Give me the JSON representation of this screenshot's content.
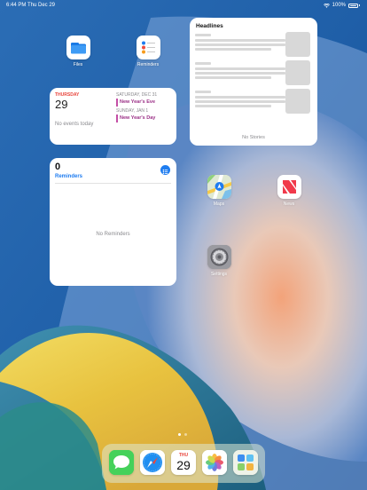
{
  "status_bar": {
    "time": "6:44 PM",
    "date": "Thu Dec 29",
    "battery": "100%"
  },
  "home": {
    "apps": [
      {
        "name": "files",
        "label": "Files",
        "icon": "folder-icon"
      },
      {
        "name": "reminders",
        "label": "Reminders",
        "icon": "reminders-list-icon"
      },
      {
        "name": "maps",
        "label": "Maps",
        "icon": "maps-icon"
      },
      {
        "name": "news",
        "label": "News",
        "icon": "news-icon"
      },
      {
        "name": "settings",
        "label": "Settings",
        "icon": "gear-icon"
      }
    ]
  },
  "calendar_widget": {
    "weekday": "THURSDAY",
    "day": "29",
    "empty_text": "No events today",
    "upcoming": [
      {
        "header": "SATURDAY, DEC 31",
        "event": "New Year's Eve"
      },
      {
        "header": "SUNDAY, JAN 1",
        "event": "New Year's Day"
      }
    ],
    "event_color": "#c44fa6"
  },
  "news_widget": {
    "title": "Headlines",
    "empty_text": "No Stories",
    "placeholder_rows": 3
  },
  "reminders_widget": {
    "count": "0",
    "list_name": "Reminders",
    "empty_text": "No Reminders",
    "accent": "#1e7cf0"
  },
  "page_indicator": {
    "pages": 2,
    "current": 1
  },
  "dock": {
    "apps": [
      {
        "name": "messages",
        "icon": "messages-icon"
      },
      {
        "name": "safari",
        "icon": "compass-icon"
      },
      {
        "name": "calendar",
        "icon": "calendar-icon",
        "weekday": "THU",
        "day": "29"
      },
      {
        "name": "photos",
        "icon": "photos-icon"
      },
      {
        "name": "app-library",
        "icon": "app-library-icon"
      }
    ]
  }
}
